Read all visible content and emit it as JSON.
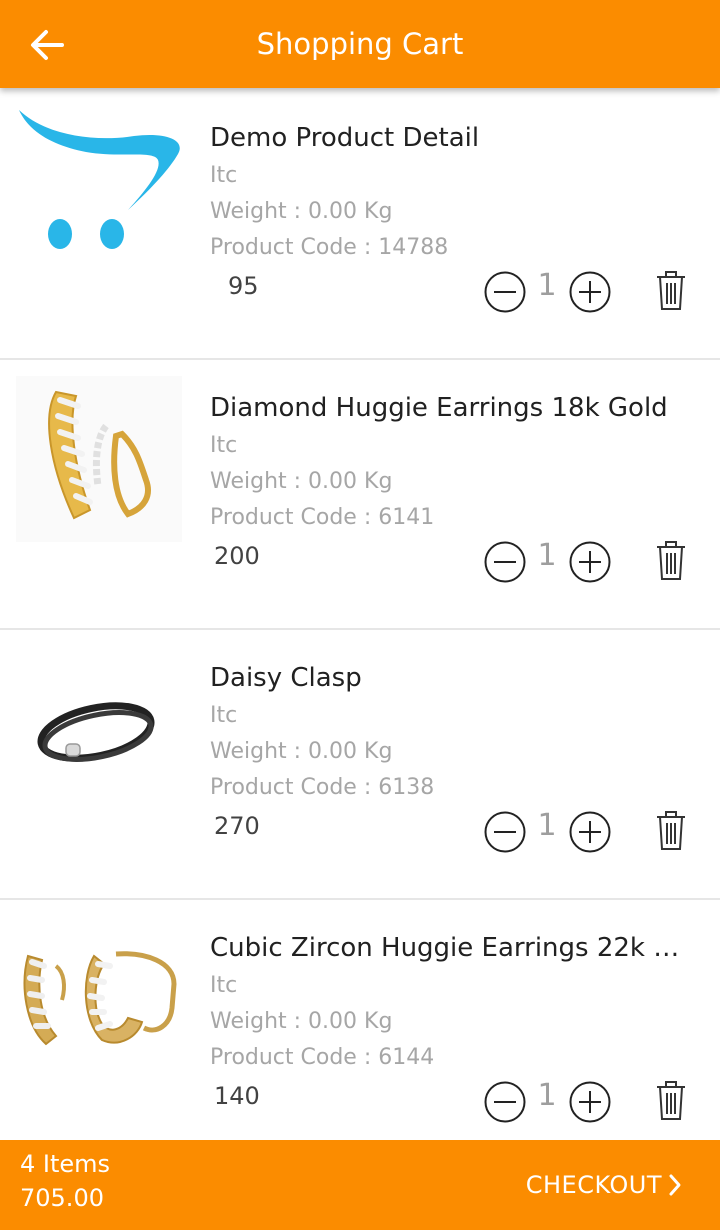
{
  "header": {
    "title": "Shopping Cart",
    "back_icon": "arrow-left-icon"
  },
  "items": [
    {
      "name": "Demo Product Detail",
      "brand": "Itc",
      "weight": "Weight : 0.00 Kg",
      "code": "Product Code : 14788",
      "price": "95",
      "qty": "1",
      "image": "cart-logo"
    },
    {
      "name": "Diamond Huggie Earrings 18k Gold",
      "brand": "Itc",
      "weight": "Weight : 0.00 Kg",
      "code": "Product Code : 6141",
      "price": "200",
      "qty": "1",
      "image": "gold-huggie-earrings"
    },
    {
      "name": "Daisy Clasp",
      "brand": "Itc",
      "weight": "Weight : 0.00 Kg",
      "code": "Product Code : 6138",
      "price": "270",
      "qty": "1",
      "image": "leather-bracelet"
    },
    {
      "name": "Cubic Zircon Huggie Earrings 22k Go...",
      "brand": "Itc",
      "weight": "Weight : 0.00 Kg",
      "code": "Product Code : 6144",
      "price": "140",
      "qty": "1",
      "image": "zircon-huggie-earrings"
    }
  ],
  "footer": {
    "items_count": "4 Items",
    "total": "705.00",
    "checkout_label": "CHECKOUT"
  },
  "colors": {
    "accent": "#fb8c00",
    "cart_logo": "#29b6e8",
    "muted_text": "#a6a6a6"
  }
}
